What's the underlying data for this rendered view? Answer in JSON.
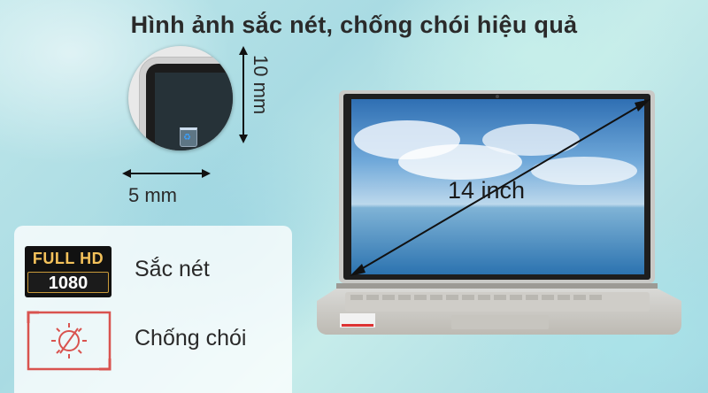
{
  "header": {
    "title": "Hình ảnh sắc nét, chống chói hiệu quả"
  },
  "bezel_dimensions": {
    "horizontal": "5 mm",
    "vertical": "10 mm"
  },
  "screen_size": "14 inch",
  "features": {
    "fhd_badge": {
      "line1": "FULL HD",
      "line2": "1080"
    },
    "sharp_label": "Sắc nét",
    "antiglare_label": "Chống chói"
  },
  "colors": {
    "badge_gold": "#f3c15a",
    "antiglare_red": "#d9534f",
    "title": "#2a2a2a"
  }
}
